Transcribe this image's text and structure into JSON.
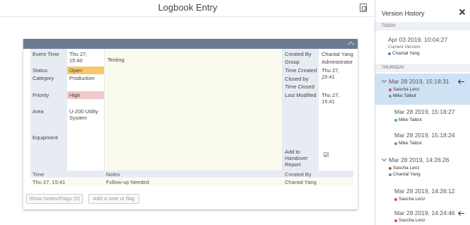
{
  "window": {
    "title": "Logbook Entry"
  },
  "entry": {
    "event_time_label": "Event Time",
    "event_time": "Thu 27, 15:40",
    "status_label": "Status",
    "status": "Open",
    "category_label": "Category",
    "category": "Production",
    "priority_label": "Priority",
    "priority": "High",
    "area_label": "Area",
    "area_line1": "U-200 Utility",
    "area_line2": "System",
    "equipment_label": "Equipment",
    "note_text": "Testing",
    "created_by_label": "Created By",
    "created_by": "Chantal Yang",
    "group_label": "Group",
    "group": "Administrator",
    "time_created_label": "Time Created",
    "time_created": "Thu 27, 15:41",
    "closed_by_label": "Closed by",
    "closed_by": "-",
    "time_closed_label": "Time Closed",
    "last_modified_label": "Last Modified",
    "last_modified": "Thu 27, 15:41",
    "handover_l1": "Add to",
    "handover_l2": "Handover",
    "handover_l3": "Report"
  },
  "notes_table": {
    "headers": [
      "Time",
      "Notes",
      "Created By"
    ],
    "rows": [
      [
        "Thu 27, 15:41",
        "Follow-up Needed",
        "Chantal Yang"
      ]
    ]
  },
  "buttons": {
    "show_notes": "Show Notes/Flags (0)",
    "add_note": "Add a note or flag"
  },
  "version_history": {
    "title": "Version History",
    "section_today": "TODAY",
    "section_thursday": "THURSDAY",
    "current_version_label": "Current Version",
    "versions": [
      {
        "time": "Apr 03 2019, 10:04:27",
        "users": [
          "Chantal Yang"
        ]
      },
      {
        "time": "Mar 28 2019, 15:18:31",
        "users": [
          "Sascha Lenz",
          "Mike Talbot"
        ]
      },
      {
        "time": "Mar 28 2019, 15:18:27",
        "users": [
          "Mike Talbot"
        ]
      },
      {
        "time": "Mar 28 2019, 15:18:24",
        "users": [
          "Mike Talbot"
        ]
      },
      {
        "time": "Mar 28 2019, 14:26:26",
        "users": [
          "Sascha Lenz",
          "Chantal Yang"
        ]
      },
      {
        "time": "Mar 28 2019, 14:26:12",
        "users": [
          "Sascha Lenz"
        ]
      },
      {
        "time": "Mar 28 2019, 14:24:46",
        "users": [
          "Sascha Lenz"
        ]
      }
    ]
  },
  "colors": {
    "sascha": "#e0474c",
    "chantal": "#4f8ede",
    "mike": "#4bb454",
    "selected": "#cfe2f5",
    "header": "#6b7a92"
  }
}
